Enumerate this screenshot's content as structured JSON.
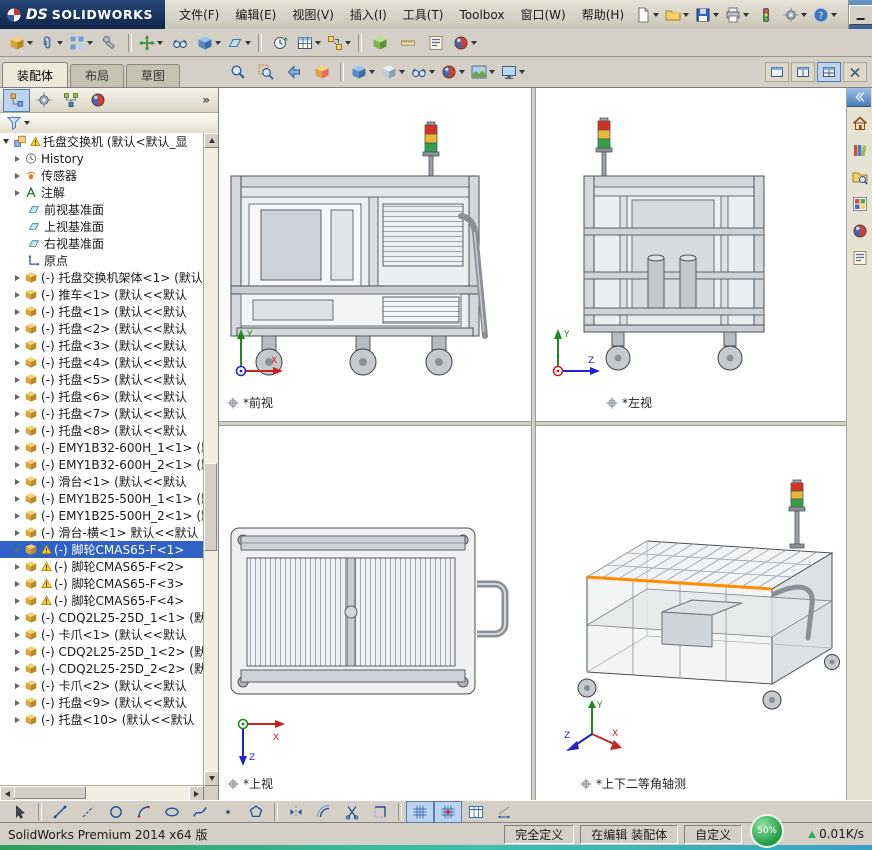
{
  "colors": {
    "accent": "#2c5d9e",
    "selection": "#2f62c4",
    "highlight_edge": "#ff8c00"
  },
  "titlebar": {
    "logo": {
      "mark": "DS",
      "text": "SOLIDWORKS"
    },
    "menus": [
      {
        "name": "file",
        "label": "文件(F)"
      },
      {
        "name": "edit",
        "label": "编辑(E)"
      },
      {
        "name": "view",
        "label": "视图(V)"
      },
      {
        "name": "insert",
        "label": "插入(I)"
      },
      {
        "name": "tools",
        "label": "工具(T)"
      },
      {
        "name": "toolbox",
        "label": "Toolbox"
      },
      {
        "name": "window",
        "label": "窗口(W)"
      },
      {
        "name": "help",
        "label": "帮助(H)"
      }
    ],
    "icons": [
      {
        "name": "new-document",
        "kind": "doc",
        "dd": true
      },
      {
        "name": "open",
        "kind": "folder",
        "dd": true
      },
      {
        "name": "save",
        "kind": "save",
        "dd": true
      },
      {
        "name": "print",
        "kind": "print",
        "dd": true
      },
      {
        "name": "rebuild",
        "kind": "rebuild"
      },
      {
        "name": "options",
        "kind": "gear",
        "dd": true
      },
      {
        "name": "help",
        "kind": "help",
        "dd": true
      }
    ],
    "window_buttons": [
      {
        "name": "window-minimize",
        "kind": "wmin"
      },
      {
        "name": "window-maximize",
        "kind": "wmax"
      },
      {
        "name": "window-close",
        "kind": "wx"
      }
    ]
  },
  "toolbar2": {
    "icons": [
      {
        "name": "insert-components",
        "kind": "cube",
        "dd": true
      },
      {
        "name": "mate",
        "kind": "mate",
        "dd": true
      },
      {
        "name": "linear-component-pattern",
        "kind": "pattern",
        "dd": true
      },
      {
        "name": "smart-fasteners",
        "kind": "fastener"
      },
      {
        "sep": true
      },
      {
        "name": "move-component",
        "kind": "move",
        "dd": true
      },
      {
        "name": "show-hidden-components",
        "kind": "eyeglass"
      },
      {
        "name": "assembly-features",
        "kind": "cubeb",
        "dd": true
      },
      {
        "name": "reference-geometry",
        "kind": "plane",
        "dd": true
      },
      {
        "sep": true
      },
      {
        "name": "new-motion-study",
        "kind": "motion"
      },
      {
        "name": "bill-of-materials",
        "kind": "bom",
        "dd": true
      },
      {
        "name": "exploded-view",
        "kind": "explode",
        "dd": true
      },
      {
        "sep": true
      },
      {
        "name": "interference-detection",
        "kind": "cubeg"
      },
      {
        "name": "measure",
        "kind": "ruler"
      },
      {
        "name": "mass-properties",
        "kind": "props"
      },
      {
        "name": "appearances",
        "kind": "ball",
        "dd": true
      }
    ]
  },
  "tabs": {
    "items": [
      {
        "name": "assembly",
        "label": "装配体",
        "active": true
      },
      {
        "name": "layout",
        "label": "布局",
        "active": false
      },
      {
        "name": "sketch",
        "label": "草图",
        "active": false
      }
    ]
  },
  "headsup": {
    "icons": [
      {
        "name": "zoom-to-fit",
        "kind": "magnifier"
      },
      {
        "name": "zoom-to-area",
        "kind": "magarea"
      },
      {
        "name": "previous-view",
        "kind": "prevview"
      },
      {
        "name": "section-view",
        "kind": "section"
      },
      {
        "sep": true
      },
      {
        "name": "view-orientation",
        "kind": "cubeb",
        "dd": true
      },
      {
        "name": "display-style",
        "kind": "displaystyle",
        "dd": true
      },
      {
        "name": "hide-show-items",
        "kind": "eyeglass",
        "dd": true
      },
      {
        "name": "edit-appearance",
        "kind": "ball",
        "dd": true
      },
      {
        "name": "apply-scene",
        "kind": "scene",
        "dd": true
      },
      {
        "name": "view-settings",
        "kind": "monitor",
        "dd": true
      }
    ]
  },
  "docwin": {
    "icons": [
      {
        "name": "viewport-single",
        "kind": "wbox"
      },
      {
        "name": "viewport-two",
        "kind": "wsplit2"
      },
      {
        "name": "viewport-four",
        "kind": "wsplit4",
        "pressed": true
      },
      {
        "name": "close-document",
        "kind": "wclose"
      }
    ]
  },
  "panel": {
    "overflow": "»",
    "manager_tabs": [
      {
        "name": "featuremanager",
        "kind": "featmgr",
        "pressed": true
      },
      {
        "name": "propertymanager",
        "kind": "gear"
      },
      {
        "name": "configurationmanager",
        "kind": "configmgr"
      },
      {
        "name": "displaymanager",
        "kind": "ball"
      }
    ]
  },
  "featuretree": {
    "items": [
      {
        "name": "pallet-exchanger-root",
        "icon": "assembly",
        "label": "托盘交换机 (默认<默认_显",
        "exp": "open",
        "warn": true,
        "lvl": 0
      },
      {
        "name": "history",
        "icon": "history",
        "label": "History",
        "exp": "closed",
        "lvl": 1
      },
      {
        "name": "sensors",
        "icon": "sensors",
        "label": "传感器",
        "exp": "closed",
        "lvl": 1
      },
      {
        "name": "annotations",
        "icon": "annot",
        "label": "注解",
        "exp": "closed",
        "lvl": 1
      },
      {
        "name": "front-plane",
        "icon": "plane",
        "label": "前视基准面",
        "lvl": 1
      },
      {
        "name": "top-plane",
        "icon": "plane",
        "label": "上视基准面",
        "lvl": 1
      },
      {
        "name": "right-plane",
        "icon": "plane",
        "label": "右视基准面",
        "lvl": 1
      },
      {
        "name": "origin",
        "icon": "origin",
        "label": "原点",
        "lvl": 1
      },
      {
        "name": "frame-assembly-1",
        "icon": "part",
        "label": "(-) 托盘交换机架体<1> (默认<<默认",
        "exp": "closed",
        "lvl": 1
      },
      {
        "name": "cart-1",
        "icon": "part",
        "label": "(-) 推车<1> (默认<<默认",
        "exp": "closed",
        "lvl": 1
      },
      {
        "name": "tray-1",
        "icon": "part",
        "label": "(-) 托盘<1> (默认<<默认",
        "exp": "closed",
        "lvl": 1
      },
      {
        "name": "tray-2",
        "icon": "part",
        "label": "(-) 托盘<2> (默认<<默认",
        "exp": "closed",
        "lvl": 1
      },
      {
        "name": "tray-3",
        "icon": "part",
        "label": "(-) 托盘<3> (默认<<默认",
        "exp": "closed",
        "lvl": 1
      },
      {
        "name": "tray-4",
        "icon": "part",
        "label": "(-) 托盘<4> (默认<<默认",
        "exp": "closed",
        "lvl": 1
      },
      {
        "name": "tray-5",
        "icon": "part",
        "label": "(-) 托盘<5> (默认<<默认",
        "exp": "closed",
        "lvl": 1
      },
      {
        "name": "tray-6",
        "icon": "part",
        "label": "(-) 托盘<6> (默认<<默认",
        "exp": "closed",
        "lvl": 1
      },
      {
        "name": "tray-7",
        "icon": "part",
        "label": "(-) 托盘<7> (默认<<默认",
        "exp": "closed",
        "lvl": 1
      },
      {
        "name": "tray-8",
        "icon": "part",
        "label": "(-) 托盘<8> (默认<<默认",
        "exp": "closed",
        "lvl": 1
      },
      {
        "name": "emy1b32-600h-1-1",
        "icon": "part",
        "label": "(-) EMY1B32-600H_1<1> (默认",
        "exp": "closed",
        "lvl": 1
      },
      {
        "name": "emy1b32-600h-2-1",
        "icon": "part",
        "label": "(-) EMY1B32-600H_2<1> (默认",
        "exp": "closed",
        "lvl": 1
      },
      {
        "name": "slide-1",
        "icon": "part",
        "label": "(-) 滑台<1> (默认<<默认",
        "exp": "closed",
        "lvl": 1
      },
      {
        "name": "emy1b25-500h-1-1",
        "icon": "part",
        "label": "(-) EMY1B25-500H_1<1> (默认",
        "exp": "closed",
        "lvl": 1
      },
      {
        "name": "emy1b25-500h-2-1",
        "icon": "part",
        "label": "(-) EMY1B25-500H_2<1> (默认",
        "exp": "closed",
        "lvl": 1
      },
      {
        "name": "slide-cross-1",
        "icon": "part",
        "label": "(-) 滑台-横<1> 默认<<默认",
        "exp": "closed",
        "lvl": 1
      },
      {
        "name": "caster-cmas65-f-1",
        "icon": "part",
        "label": "(-) 脚轮CMAS65-F<1>",
        "exp": "closed",
        "warn": true,
        "sel": true,
        "lvl": 1
      },
      {
        "name": "caster-cmas65-f-2",
        "icon": "part",
        "label": "(-) 脚轮CMAS65-F<2>",
        "exp": "closed",
        "warn": true,
        "lvl": 1
      },
      {
        "name": "caster-cmas65-f-3",
        "icon": "part",
        "label": "(-) 脚轮CMAS65-F<3>",
        "exp": "closed",
        "warn": true,
        "lvl": 1
      },
      {
        "name": "caster-cmas65-f-4",
        "icon": "part",
        "label": "(-) 脚轮CMAS65-F<4>",
        "exp": "closed",
        "warn": true,
        "lvl": 1
      },
      {
        "name": "cdq2l25-25d-1-1",
        "icon": "part",
        "label": "(-) CDQ2L25-25D_1<1> (默认",
        "exp": "closed",
        "lvl": 1
      },
      {
        "name": "gripper-1",
        "icon": "part",
        "label": "(-) 卡爪<1> (默认<<默认",
        "exp": "closed",
        "lvl": 1
      },
      {
        "name": "cdq2l25-25d-1-2",
        "icon": "part",
        "label": "(-) CDQ2L25-25D_1<2> (默认",
        "exp": "closed",
        "lvl": 1
      },
      {
        "name": "cdq2l25-25d-2-2",
        "icon": "part",
        "label": "(-) CDQ2L25-25D_2<2> (默认",
        "exp": "closed",
        "lvl": 1
      },
      {
        "name": "gripper-2",
        "icon": "part",
        "label": "(-) 卡爪<2> (默认<<默认",
        "exp": "closed",
        "lvl": 1
      },
      {
        "name": "tray-9",
        "icon": "part",
        "label": "(-) 托盘<9> (默认<<默认",
        "exp": "closed",
        "lvl": 1
      },
      {
        "name": "tray-10",
        "icon": "part",
        "label": "(-) 托盘<10> (默认<<默认",
        "exp": "closed",
        "lvl": 1
      }
    ]
  },
  "viewports": {
    "front": {
      "label": "*前视"
    },
    "left": {
      "label": "*左视"
    },
    "top": {
      "label": "*上视"
    },
    "iso": {
      "label": "*上下二等角轴测"
    },
    "axes": {
      "x": "X",
      "y": "Y",
      "z": "Z"
    }
  },
  "taskpane": {
    "icons": [
      {
        "name": "solidworks-resources",
        "kind": "house"
      },
      {
        "name": "design-library",
        "kind": "library"
      },
      {
        "name": "file-explorer",
        "kind": "foldermag"
      },
      {
        "name": "view-palette",
        "kind": "palette"
      },
      {
        "name": "appearances-scenes",
        "kind": "ball"
      },
      {
        "name": "custom-properties",
        "kind": "props"
      }
    ]
  },
  "sketchbar": {
    "icons": [
      {
        "name": "select",
        "kind": "select"
      },
      {
        "sep": true
      },
      {
        "name": "sketch-line",
        "kind": "line"
      },
      {
        "name": "centerline",
        "kind": "centerline"
      },
      {
        "name": "sketch-circle",
        "kind": "circle"
      },
      {
        "name": "sketch-arc",
        "kind": "arc"
      },
      {
        "name": "sketch-ellipse",
        "kind": "ellipse"
      },
      {
        "name": "sketch-spline",
        "kind": "spline"
      },
      {
        "name": "sketch-point",
        "kind": "point"
      },
      {
        "name": "sketch-polygon",
        "kind": "polygon"
      },
      {
        "sep": true
      },
      {
        "name": "mirror-entities",
        "kind": "mirror"
      },
      {
        "name": "offset-entities",
        "kind": "offset"
      },
      {
        "name": "trim-entities",
        "kind": "trim"
      },
      {
        "name": "convert-entities",
        "kind": "convert"
      },
      {
        "sep": true
      },
      {
        "name": "grid-snap",
        "kind": "grid",
        "pressed": true
      },
      {
        "name": "snap-points",
        "kind": "snap",
        "pressed": true
      },
      {
        "name": "design-table",
        "kind": "table"
      },
      {
        "name": "smart-dimension",
        "kind": "dim"
      }
    ]
  },
  "statusbar": {
    "left": "SolidWorks Premium 2014 x64 版",
    "defined": "完全定义",
    "editing": "在编辑 装配体",
    "custom": "自定义",
    "badge": "50%",
    "speed": "0.01K/s"
  }
}
